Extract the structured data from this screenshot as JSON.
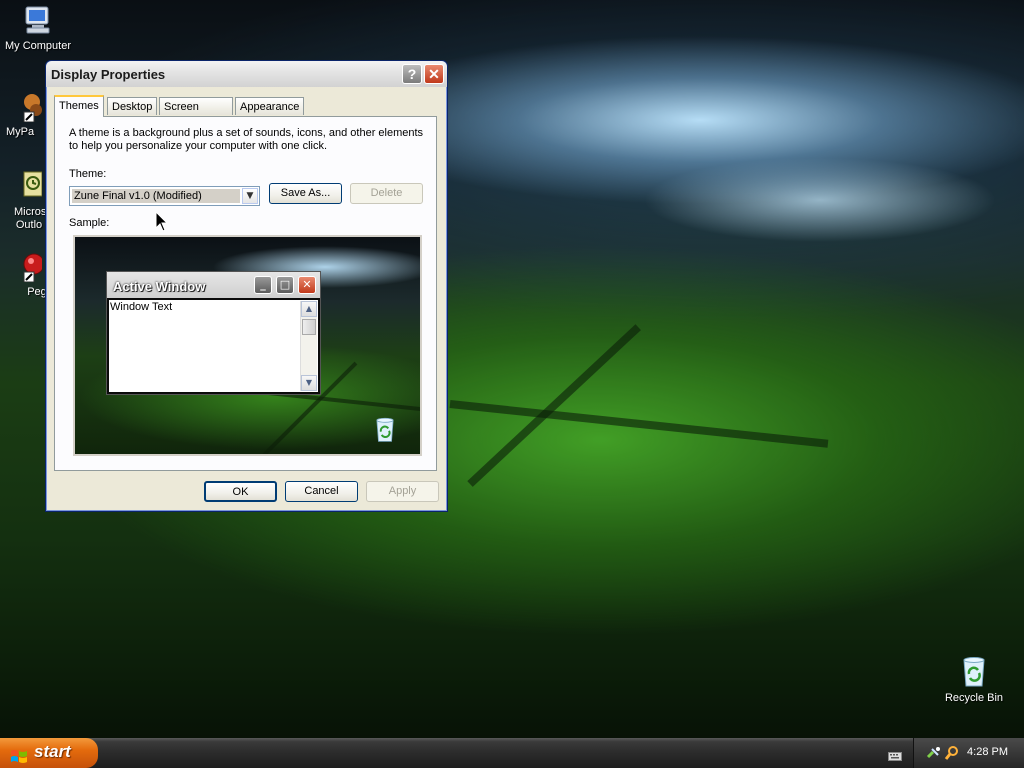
{
  "desktop": {
    "icons": [
      {
        "name": "my-computer",
        "label": "My Computer"
      },
      {
        "name": "mypa",
        "label": "MyPa"
      },
      {
        "name": "outlook",
        "label": "Micros Outlo"
      },
      {
        "name": "peg",
        "label": "Peg"
      },
      {
        "name": "recycle-bin",
        "label": "Recycle Bin"
      }
    ]
  },
  "dialog": {
    "title": "Display Properties",
    "help_glyph": "?",
    "close_glyph": "✕",
    "tabs": [
      "Themes",
      "Desktop",
      "Screen Saver",
      "Appearance"
    ],
    "active_tab": "Themes",
    "description": "A theme is a background plus a set of sounds, icons, and other elements to help you personalize your computer with one click.",
    "theme_label": "Theme:",
    "theme_value": "Zune Final v1.0 (Modified)",
    "save_as_label": "Save As...",
    "delete_label": "Delete",
    "sample_label": "Sample:",
    "sample_window": {
      "title": "Active Window",
      "body_text": "Window Text"
    },
    "ok_label": "OK",
    "cancel_label": "Cancel",
    "apply_label": "Apply"
  },
  "taskbar": {
    "start_label": "start",
    "clock": "4:28 PM"
  },
  "colors": {
    "start_orange": "#e46b0d",
    "dialog_face": "#ece9d8",
    "close_red": "#c0391b",
    "tab_highlight": "#ffc83c"
  }
}
